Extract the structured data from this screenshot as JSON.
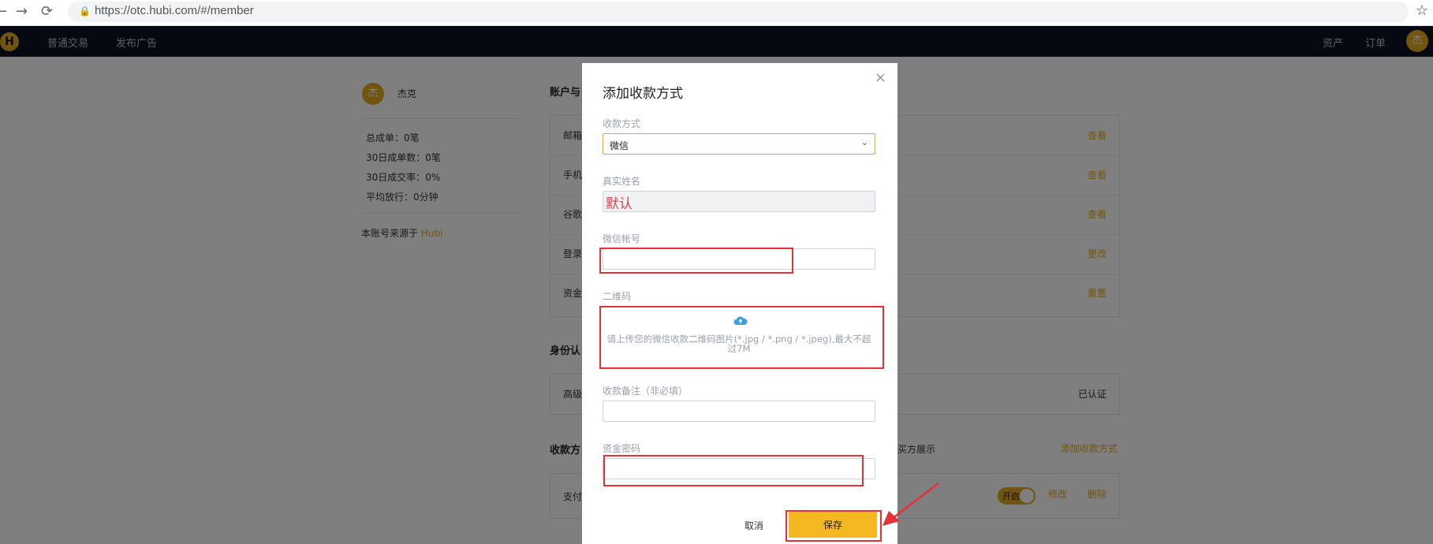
{
  "browser": {
    "back": "←",
    "forward": "→",
    "reload": "⟳",
    "url": "https://otc.hubi.com/#/member"
  },
  "topnav": {
    "logo": "H",
    "items": [
      "普通交易",
      "发布广告"
    ],
    "right_items": [
      "资产",
      "订单"
    ],
    "avatar": "杰"
  },
  "profile": {
    "avatar": "杰",
    "name": "杰克",
    "stats": [
      "总成单：0笔",
      "30日成单数：0笔",
      "30日成交率：0%",
      "平均放行：0分钟"
    ],
    "source_prefix": "本账号来源于 ",
    "source_link": "Hubi"
  },
  "sections": {
    "account_title": "账户与",
    "account_rows": [
      {
        "label": "邮箱",
        "action": "查看"
      },
      {
        "label": "手机",
        "action": "查看"
      },
      {
        "label": "谷歌",
        "action": "查看"
      },
      {
        "label": "登录",
        "action": "更改"
      },
      {
        "label": "资金",
        "action": "重置"
      }
    ],
    "identity_title": "身份认",
    "identity_row": {
      "label": "高级",
      "status": "已认证"
    },
    "payment_title": "收款方",
    "buyer_show": "买方展示",
    "add_method": "添加收款方式",
    "payment_row": {
      "label": "支付",
      "toggle": "开启",
      "edit": "修改",
      "delete": "删除"
    }
  },
  "modal": {
    "title": "添加收款方式",
    "close": "×",
    "method_label": "收款方式",
    "method_value": "微信",
    "realname_label": "真实姓名",
    "realname_value": "默认",
    "account_label": "微信帐号",
    "account_value": "",
    "qr_label": "二维码",
    "qr_hint": "请上传您的微信收款二维码图片(*.jpg / *.png / *.jpeg),最大不超过7M",
    "note_label": "收款备注（非必填）",
    "note_value": "",
    "fund_pwd_label": "资金密码",
    "fund_pwd_value": "",
    "cancel": "取消",
    "save": "保存"
  },
  "colors": {
    "accent": "#f5b821",
    "nav_bg": "#0c1325",
    "annotation": "#e53238"
  }
}
